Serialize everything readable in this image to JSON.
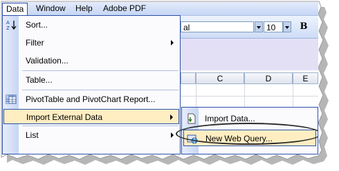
{
  "menubar": {
    "items": [
      "Data",
      "Window",
      "Help",
      "Adobe PDF"
    ]
  },
  "toolbar": {
    "font_name": "al",
    "font_size": "10",
    "bold_label": "B"
  },
  "grid": {
    "columns": [
      "C",
      "D",
      "E"
    ]
  },
  "menu": {
    "items": [
      {
        "label": "Sort...",
        "icon": "sort-az-icon"
      },
      {
        "label": "Filter",
        "submenu": true
      },
      {
        "label": "Validation..."
      },
      {
        "label": "Table..."
      },
      {
        "label": "PivotTable and PivotChart Report...",
        "icon": "pivot-table-icon"
      },
      {
        "label": "Import External Data",
        "submenu": true,
        "highlighted": true
      },
      {
        "label": "List",
        "submenu": true
      }
    ]
  },
  "submenu": {
    "items": [
      {
        "label": "Import Data...",
        "icon": "import-data-icon"
      },
      {
        "label": "New Web Query...",
        "icon": "web-query-icon",
        "highlighted": true
      }
    ]
  }
}
